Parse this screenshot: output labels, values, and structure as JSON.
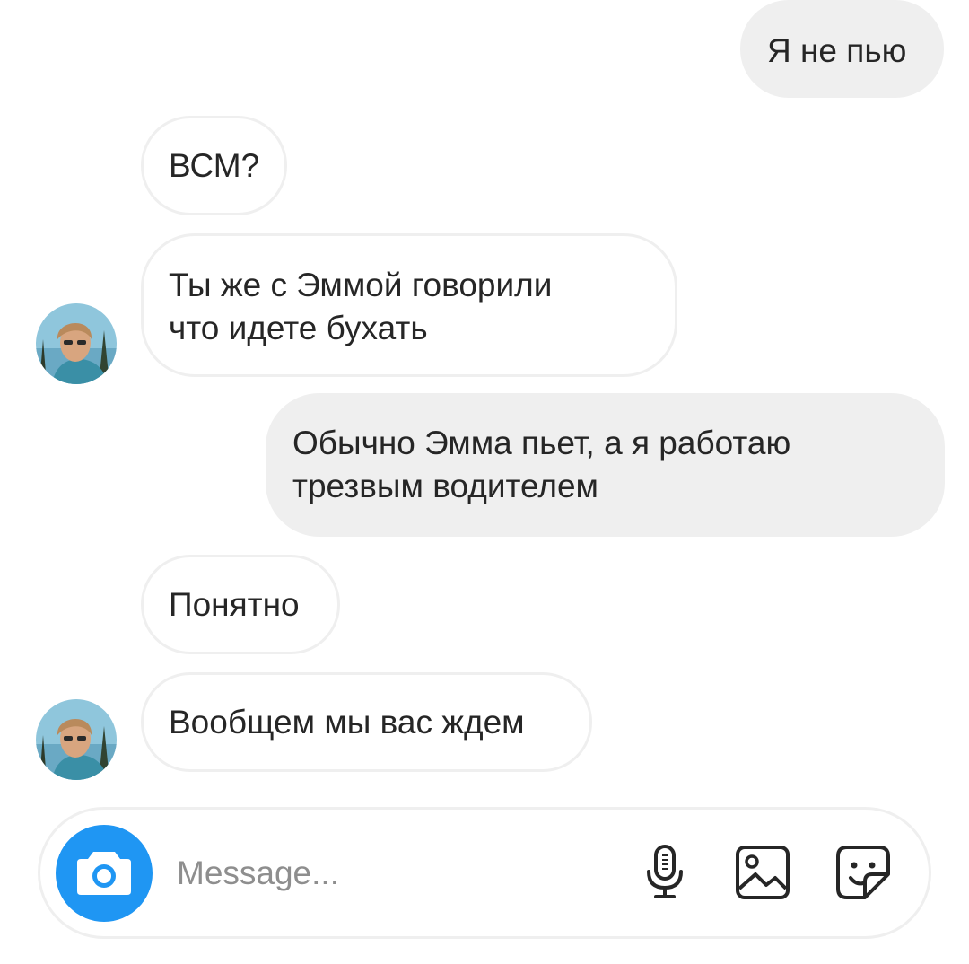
{
  "messages": [
    {
      "from": "me",
      "text": "Я не пью"
    },
    {
      "from": "them",
      "text": "ВСМ?"
    },
    {
      "from": "them",
      "lines": [
        "Ты же с Эммой говорили",
        "что идете бухать"
      ]
    },
    {
      "from": "me",
      "lines": [
        "Обычно Эмма пьет, а я работаю",
        "трезвым водителем"
      ]
    },
    {
      "from": "them",
      "text": "Понятно"
    },
    {
      "from": "them",
      "text": "Вообщем мы вас ждем"
    }
  ],
  "composer": {
    "placeholder": "Message...",
    "accent_color": "#1f96f3",
    "icons": [
      "camera-icon",
      "microphone-icon",
      "gallery-icon",
      "sticker-icon"
    ]
  },
  "colors": {
    "outgoing_bubble": "#efefef",
    "incoming_border": "#efefef",
    "text": "#262626",
    "placeholder": "#8e8e8e"
  }
}
